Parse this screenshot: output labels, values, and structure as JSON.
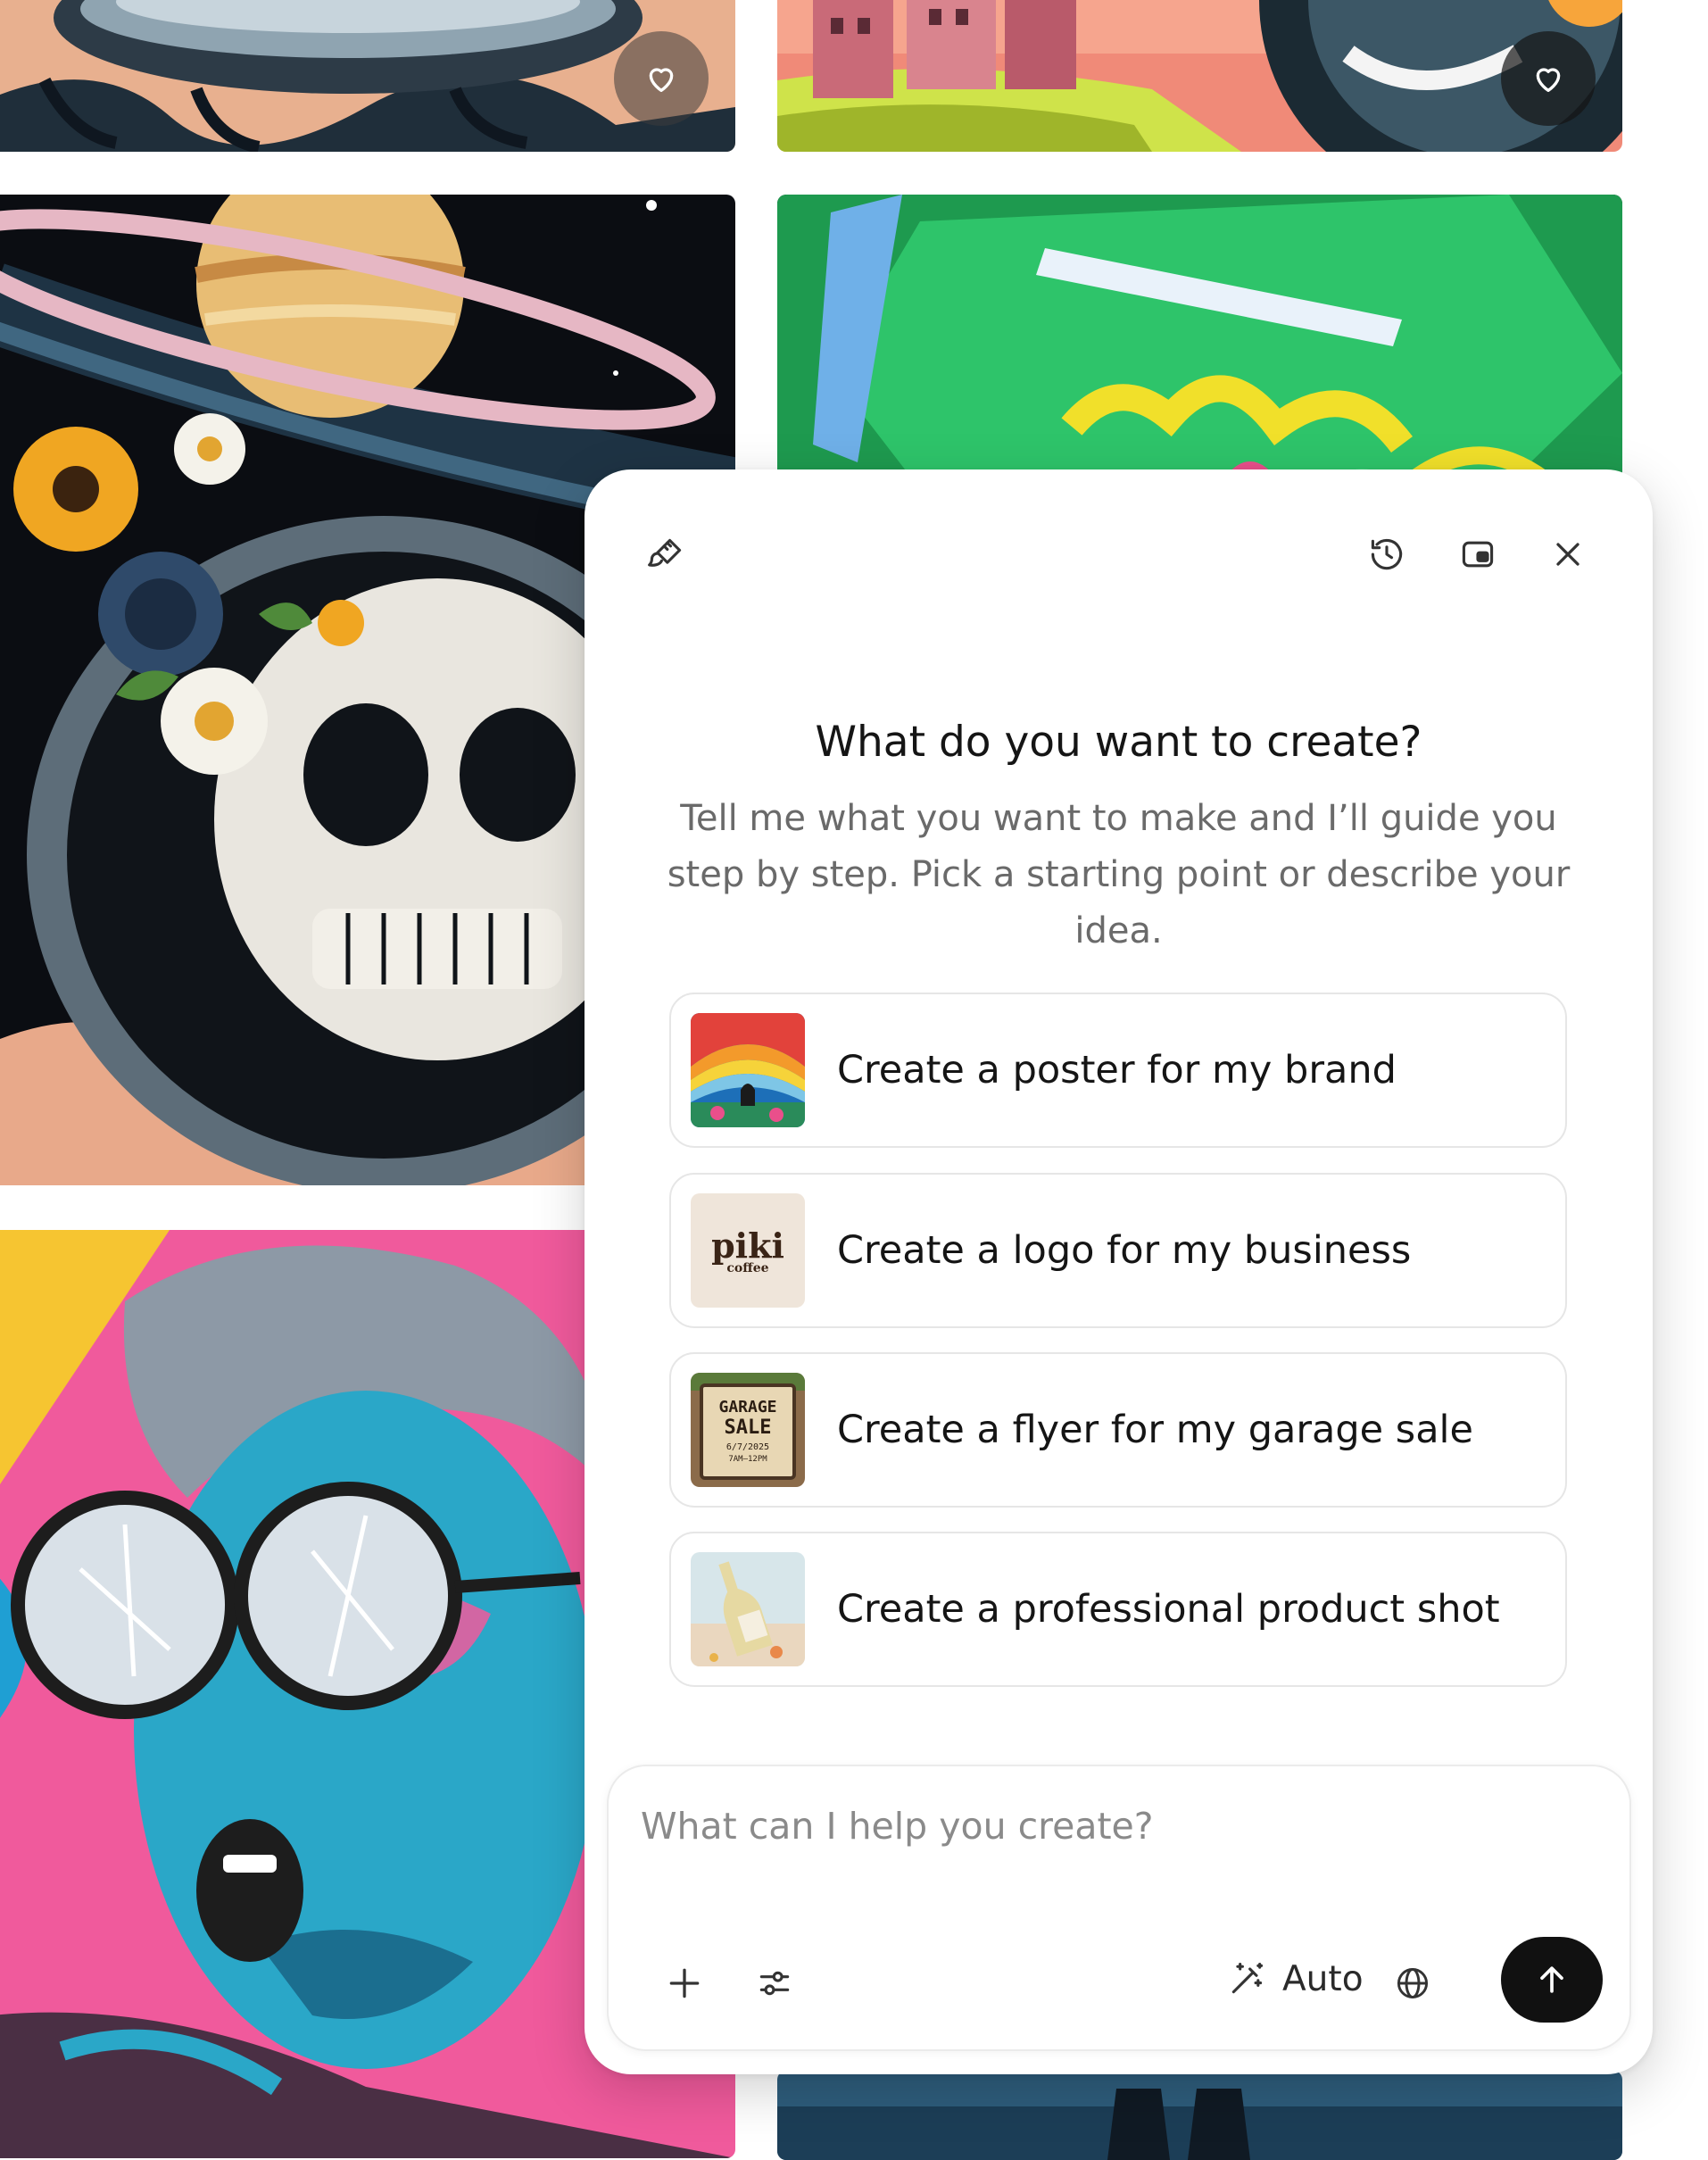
{
  "gallery": {
    "favorite_icon": "heart-icon",
    "tiles": [
      "astronaut-hatch-art",
      "pink-castle-art",
      "skull-astronaut-art",
      "green-comic-art",
      "pop-art-portrait",
      "blue-figure-art"
    ]
  },
  "assistant": {
    "header_icons": [
      "paint-brush-icon",
      "history-icon",
      "picture-in-picture-icon",
      "close-icon"
    ],
    "heading": "What do you want to create?",
    "subtitle": "Tell me what you want to make and I’ll guide you step by step. Pick a starting point or describe your idea.",
    "suggestions": [
      {
        "label": "Create a poster for my brand",
        "thumb": "rainbow-poster"
      },
      {
        "label": "Create a logo for my business",
        "thumb": "piki-coffee-logo",
        "thumb_title": "piki",
        "thumb_sub": "coffee"
      },
      {
        "label": "Create a flyer for my garage sale",
        "thumb": "garage-sale-sign",
        "thumb_title": "GARAGE",
        "thumb_title2": "SALE",
        "thumb_date": "6/7/2025",
        "thumb_time": "7AM–12PM"
      },
      {
        "label": "Create a professional product shot",
        "thumb": "wine-bottle-shot"
      }
    ],
    "composer": {
      "placeholder": "What can I help you create?",
      "mode_label": "Auto",
      "tools": [
        "plus-icon",
        "sliders-icon",
        "magic-wand-icon",
        "globe-icon",
        "arrow-up-icon"
      ]
    }
  },
  "colors": {
    "send_button": "#111111",
    "heading": "#151515",
    "subtitle": "#6a6a6a",
    "card_border": "#e6e6e6"
  }
}
